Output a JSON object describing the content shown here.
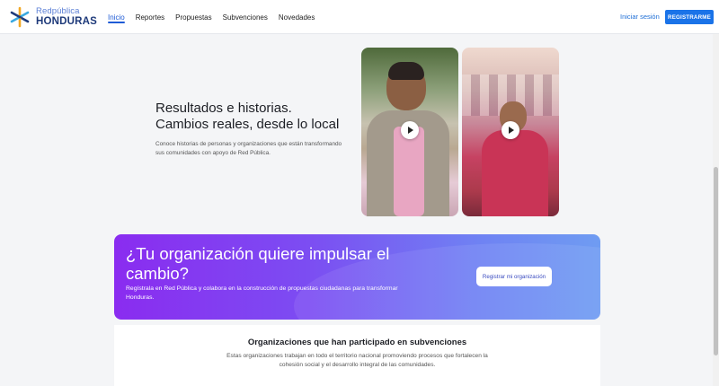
{
  "header": {
    "logo": {
      "top": "Redpública",
      "bottom": "HONDURAS"
    },
    "nav": [
      {
        "label": "Inicio",
        "active": true
      },
      {
        "label": "Reportes",
        "active": false
      },
      {
        "label": "Propuestas",
        "active": false
      },
      {
        "label": "Subvenciones",
        "active": false
      },
      {
        "label": "Novedades",
        "active": false
      }
    ],
    "login_label": "Iniciar sesión",
    "register_label": "REGISTRARME"
  },
  "hero": {
    "title_line1": "Resultados e historias.",
    "title_line2": "Cambios reales, desde lo local",
    "description": "Conoce historias de personas y organizaciones que están transformando sus comunidades con apoyo de Red Pública."
  },
  "cta": {
    "title": "¿Tu organización quiere impulsar el cambio?",
    "description": "Regístrala en Red Pública y colabora en la construcción de propuestas ciudadanas para transformar Honduras.",
    "button_label": "Registrar mi organización"
  },
  "organizations": {
    "title": "Organizaciones que han participado en subvenciones",
    "description": "Estas organizaciones trabajan en todo el territorio nacional promoviendo procesos que fortalecen la cohesión social y el desarrollo integral de las comunidades."
  },
  "colors": {
    "accent": "#1a73e8",
    "cta_gradient_start": "#8a2cf0",
    "cta_gradient_end": "#6f9cf2"
  },
  "icons": [
    "redpublica-logo",
    "play-icon"
  ]
}
